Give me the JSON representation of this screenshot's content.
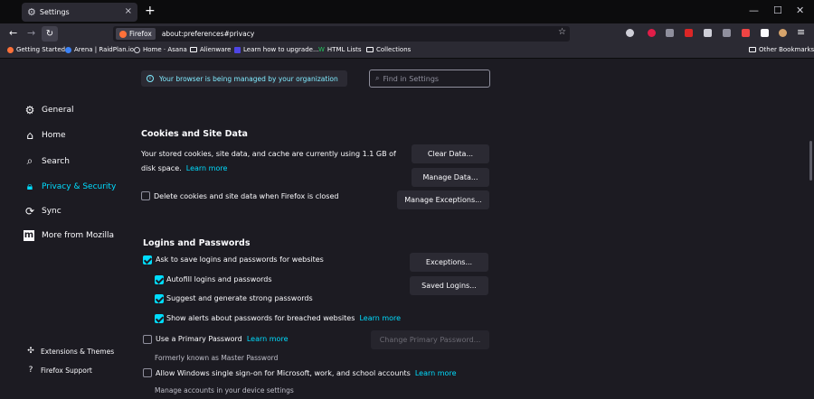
{
  "tab": {
    "title": "Settings",
    "close": "×",
    "new": "+"
  },
  "window": {
    "minimize": "—",
    "maximize": "☐",
    "close": "✕"
  },
  "toolbar": {
    "back": "←",
    "forward": "→",
    "reload": "↻",
    "identity": "Firefox",
    "url": "about:preferences#privacy",
    "bookmark_star": "☆"
  },
  "bookmarks": [
    {
      "label": "Getting Started",
      "color": "#ff7139"
    },
    {
      "label": "Arena | RaidPlan.io",
      "color": "#3b82f6"
    },
    {
      "label": "Home · Asana",
      "color": "#cfcfd8"
    },
    {
      "label": "Alienware",
      "folder": true
    },
    {
      "label": "Learn how to upgrade...",
      "color": "#4f46e5"
    },
    {
      "label": "HTML Lists",
      "color": "#22c55e"
    },
    {
      "label": "Collections",
      "folder": true
    }
  ],
  "other_bookmarks": "Other Bookmarks",
  "policy_notice": "Your browser is being managed by your organization",
  "search_placeholder": "Find in Settings",
  "sidebar": {
    "items": [
      {
        "label": "General",
        "icon": "gear-icon"
      },
      {
        "label": "Home",
        "icon": "home-icon"
      },
      {
        "label": "Search",
        "icon": "search-icon"
      },
      {
        "label": "Privacy & Security",
        "icon": "lock-icon"
      },
      {
        "label": "Sync",
        "icon": "sync-icon"
      },
      {
        "label": "More from Mozilla",
        "icon": "mozilla-icon"
      }
    ],
    "footer": [
      {
        "label": "Extensions & Themes",
        "icon": "puzzle-icon"
      },
      {
        "label": "Firefox Support",
        "icon": "help-icon"
      }
    ]
  },
  "cookies": {
    "heading": "Cookies and Site Data",
    "desc_line1": "Your stored cookies, site data, and cache are currently using 1.1 GB of",
    "desc_line2": "disk space.",
    "learn_more": "Learn more",
    "clear_data": "Clear Data...",
    "manage_data": "Manage Data...",
    "manage_exceptions": "Manage Exceptions...",
    "delete_on_close": "Delete cookies and site data when Firefox is closed"
  },
  "logins": {
    "heading": "Logins and Passwords",
    "ask_to_save": "Ask to save logins and passwords for websites",
    "autofill": "Autofill logins and passwords",
    "suggest": "Suggest and generate strong passwords",
    "alerts": "Show alerts about passwords for breached websites",
    "alerts_learn_more": "Learn more",
    "exceptions": "Exceptions...",
    "saved_logins": "Saved Logins...",
    "primary_password": "Use a Primary Password",
    "primary_learn_more": "Learn more",
    "change_primary": "Change Primary Password...",
    "formerly": "Formerly known as Master Password",
    "sso": "Allow Windows single sign-on for Microsoft, work, and school accounts",
    "sso_learn_more": "Learn more",
    "sso_sub": "Manage accounts in your device settings"
  },
  "colors": {
    "accent": "#00ddff",
    "bg": "#1c1b22",
    "panel": "#2b2a33"
  }
}
